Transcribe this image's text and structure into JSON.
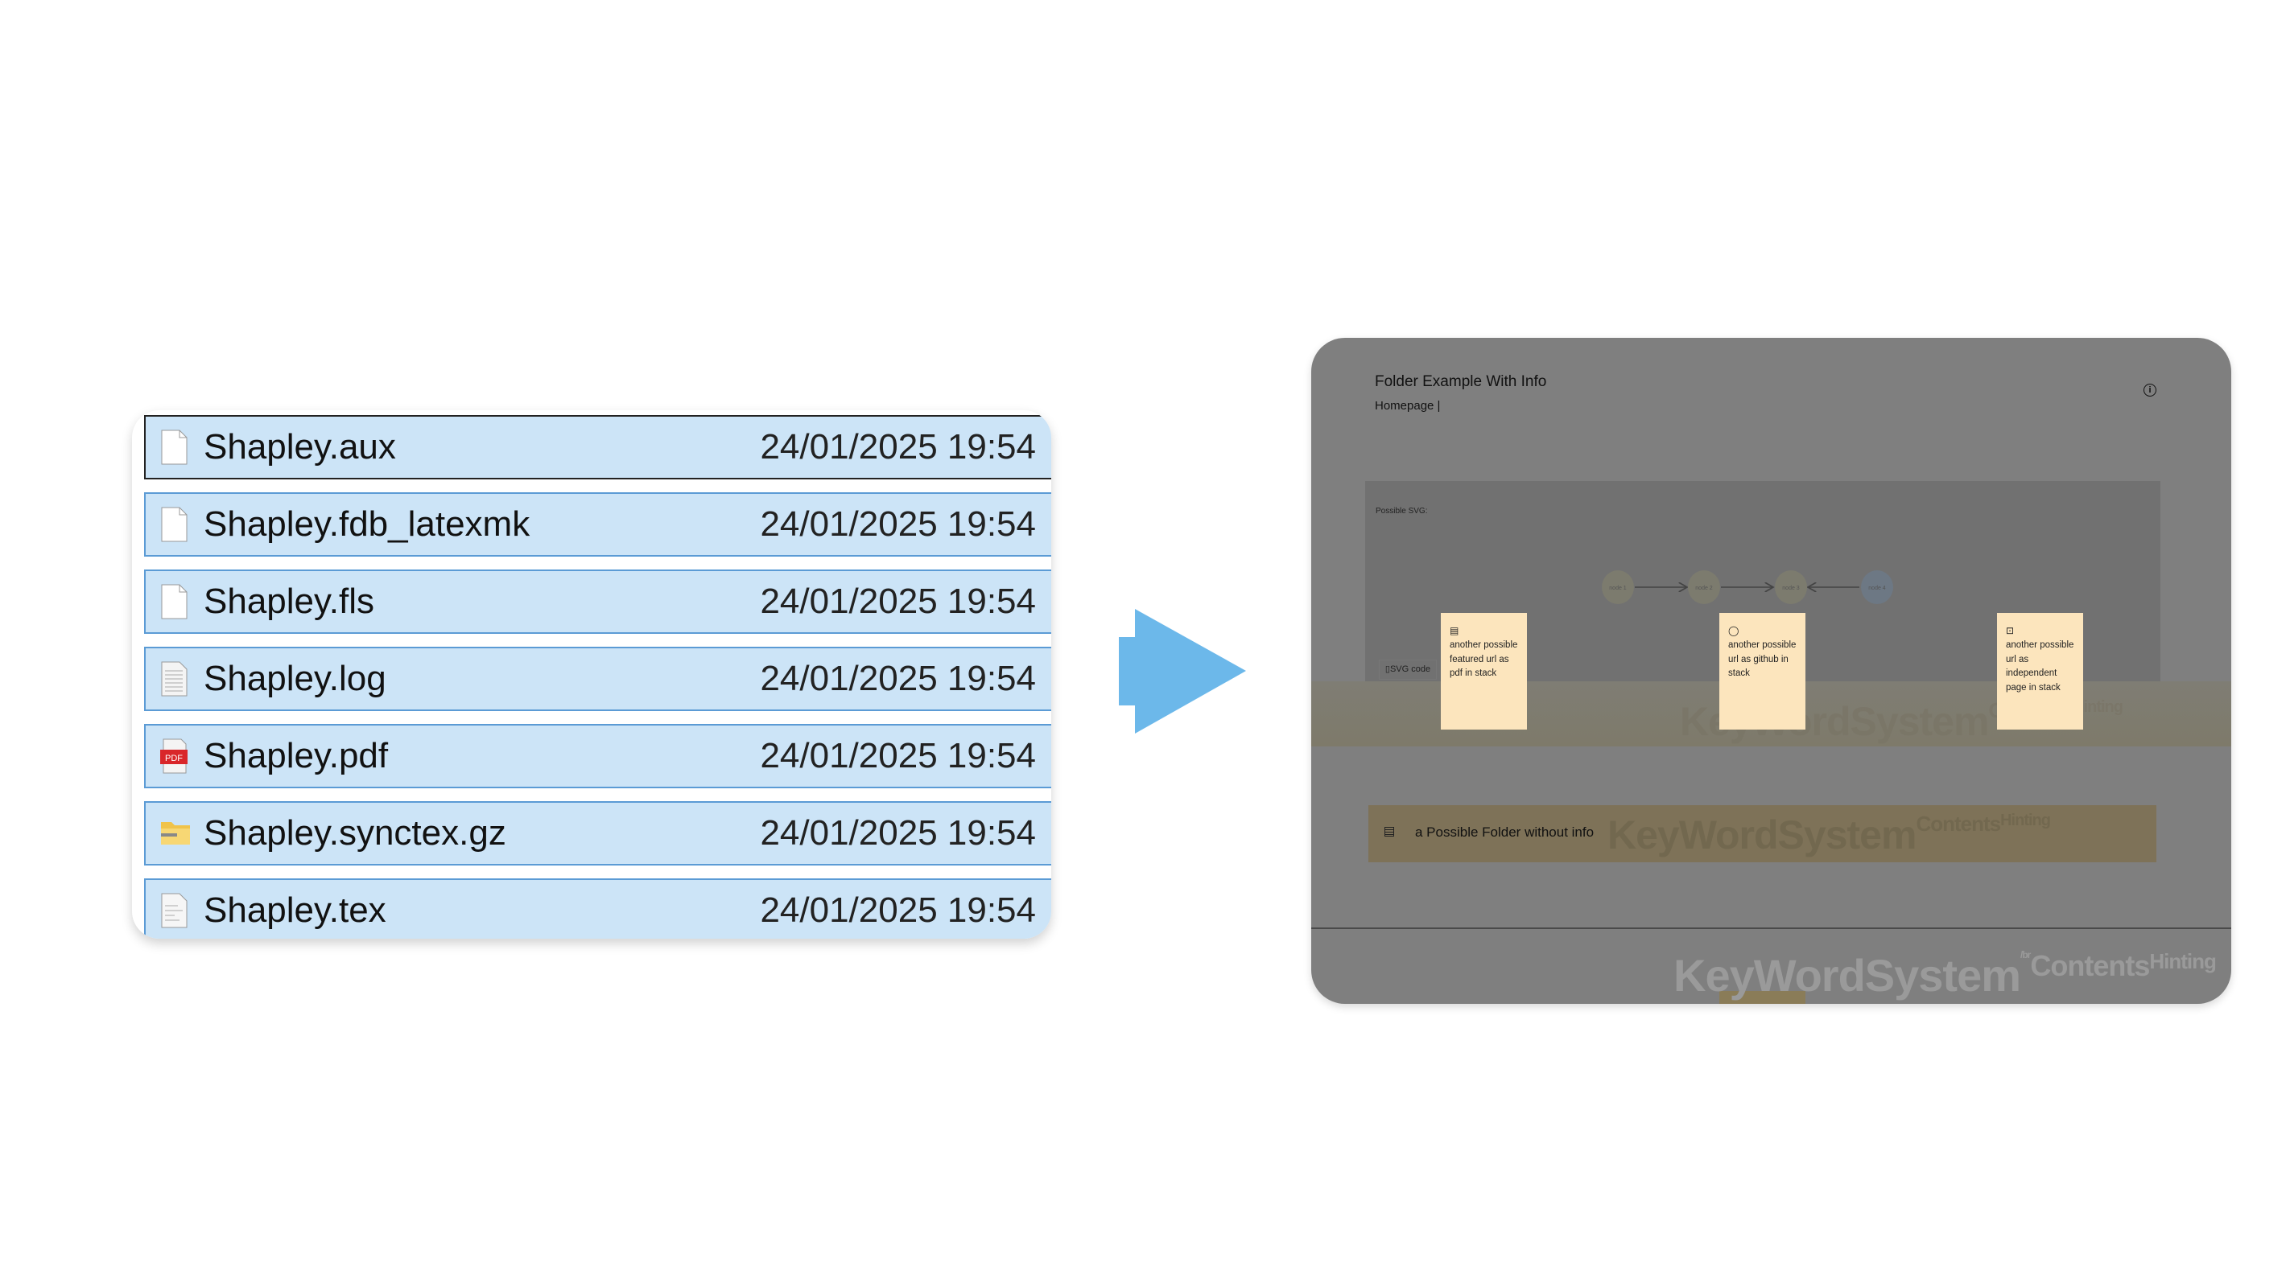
{
  "file_list": {
    "files": [
      {
        "name": "Shapley.aux",
        "date": "24/01/2025 19:54",
        "icon": "blank-file-icon"
      },
      {
        "name": "Shapley.fdb_latexmk",
        "date": "24/01/2025 19:54",
        "icon": "blank-file-icon"
      },
      {
        "name": "Shapley.fls",
        "date": "24/01/2025 19:54",
        "icon": "blank-file-icon"
      },
      {
        "name": "Shapley.log",
        "date": "24/01/2025 19:54",
        "icon": "text-file-icon"
      },
      {
        "name": "Shapley.pdf",
        "date": "24/01/2025 19:54",
        "icon": "pdf-file-icon"
      },
      {
        "name": "Shapley.synctex.gz",
        "date": "24/01/2025 19:54",
        "icon": "zip-folder-icon"
      },
      {
        "name": "Shapley.tex",
        "date": "24/01/2025 19:54",
        "icon": "tex-file-icon"
      }
    ]
  },
  "arrow_color": "#6cb8ea",
  "panel": {
    "title": "Folder Example With Info",
    "breadcrumb": "Homepage |",
    "info_icon": "i",
    "svg_label": "Possible SVG:",
    "svg_code_button": "SVG code",
    "nodes": [
      "node 1",
      "node 2",
      "node 3",
      "node 4"
    ],
    "cards": [
      {
        "icon": "pdf-icon",
        "text": "another possible featured url as pdf in stack"
      },
      {
        "icon": "github-icon",
        "text": "another possible url as github in stack"
      },
      {
        "icon": "page-icon",
        "text": "another possible url as independent page in stack"
      }
    ],
    "folder_label": "a Possible Folder without info",
    "watermark": {
      "main": "KeyWordSystem",
      "sup": "™",
      "sup_bottom": "/br",
      "tail": "Contents",
      "tail2": "Hinting"
    }
  }
}
